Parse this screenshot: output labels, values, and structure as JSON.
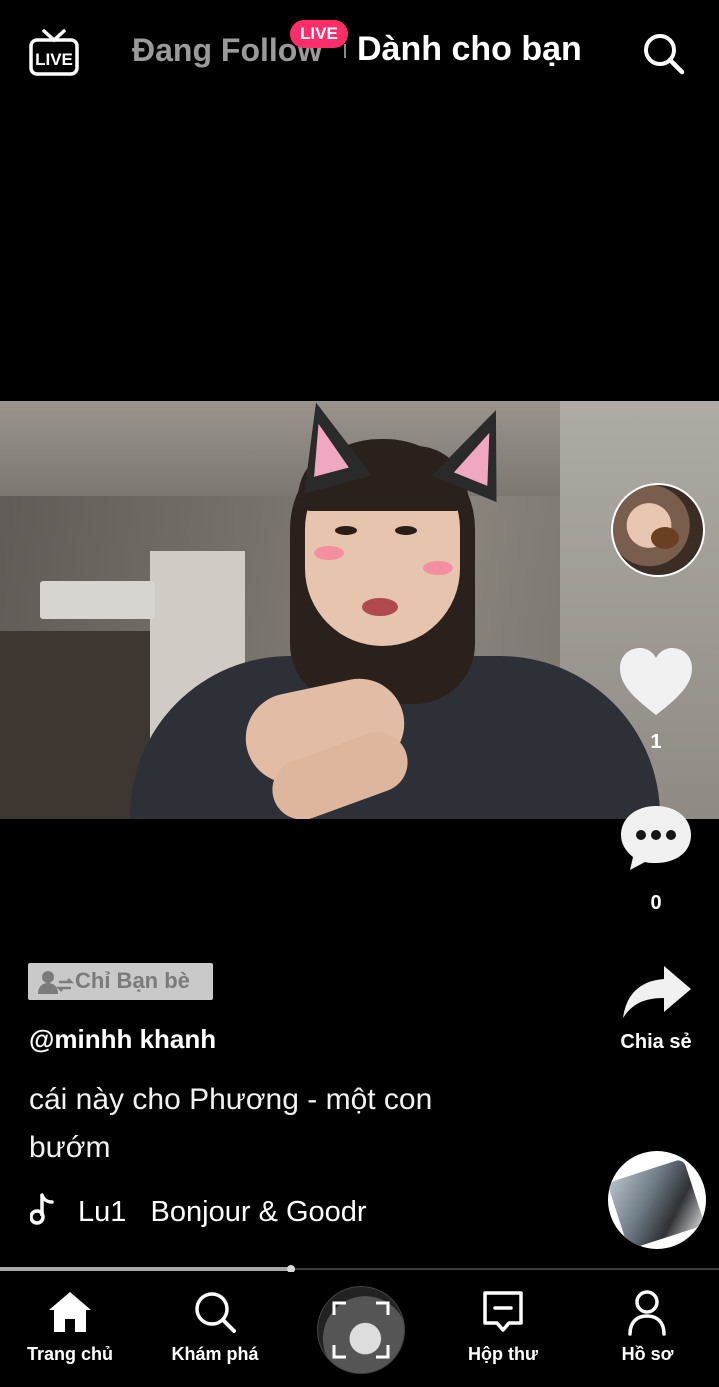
{
  "header": {
    "live_icon_text": "LIVE",
    "tabs": [
      {
        "label": "Đang Follow",
        "active": false
      },
      {
        "label": "Dành cho bạn",
        "active": true
      }
    ],
    "live_badge": "LIVE"
  },
  "video": {
    "privacy": "Chỉ Bạn bè",
    "username": "@minhh khanh",
    "caption": "cái này cho Phương - một con bướm",
    "music": "Lu1   Bonjour & Goodr",
    "progress": 0.405
  },
  "actions": {
    "like_count": "1",
    "comment_count": "0",
    "share_label": "Chia sẻ"
  },
  "nav": {
    "home": "Trang chủ",
    "discover": "Khám phá",
    "inbox": "Hộp thư",
    "profile": "Hồ sơ"
  },
  "colors": {
    "background": "#000000",
    "live_badge": "#ff2d6a",
    "inactive_tab": "#9a9a9a",
    "privacy_badge": "#c9c9c9"
  },
  "icons": [
    "live-tv-icon",
    "search-icon",
    "heart-icon",
    "comment-icon",
    "share-arrow-icon",
    "music-note-icon",
    "privacy-friends-icon",
    "home-icon",
    "discover-icon",
    "create-icon",
    "inbox-icon",
    "profile-icon"
  ]
}
